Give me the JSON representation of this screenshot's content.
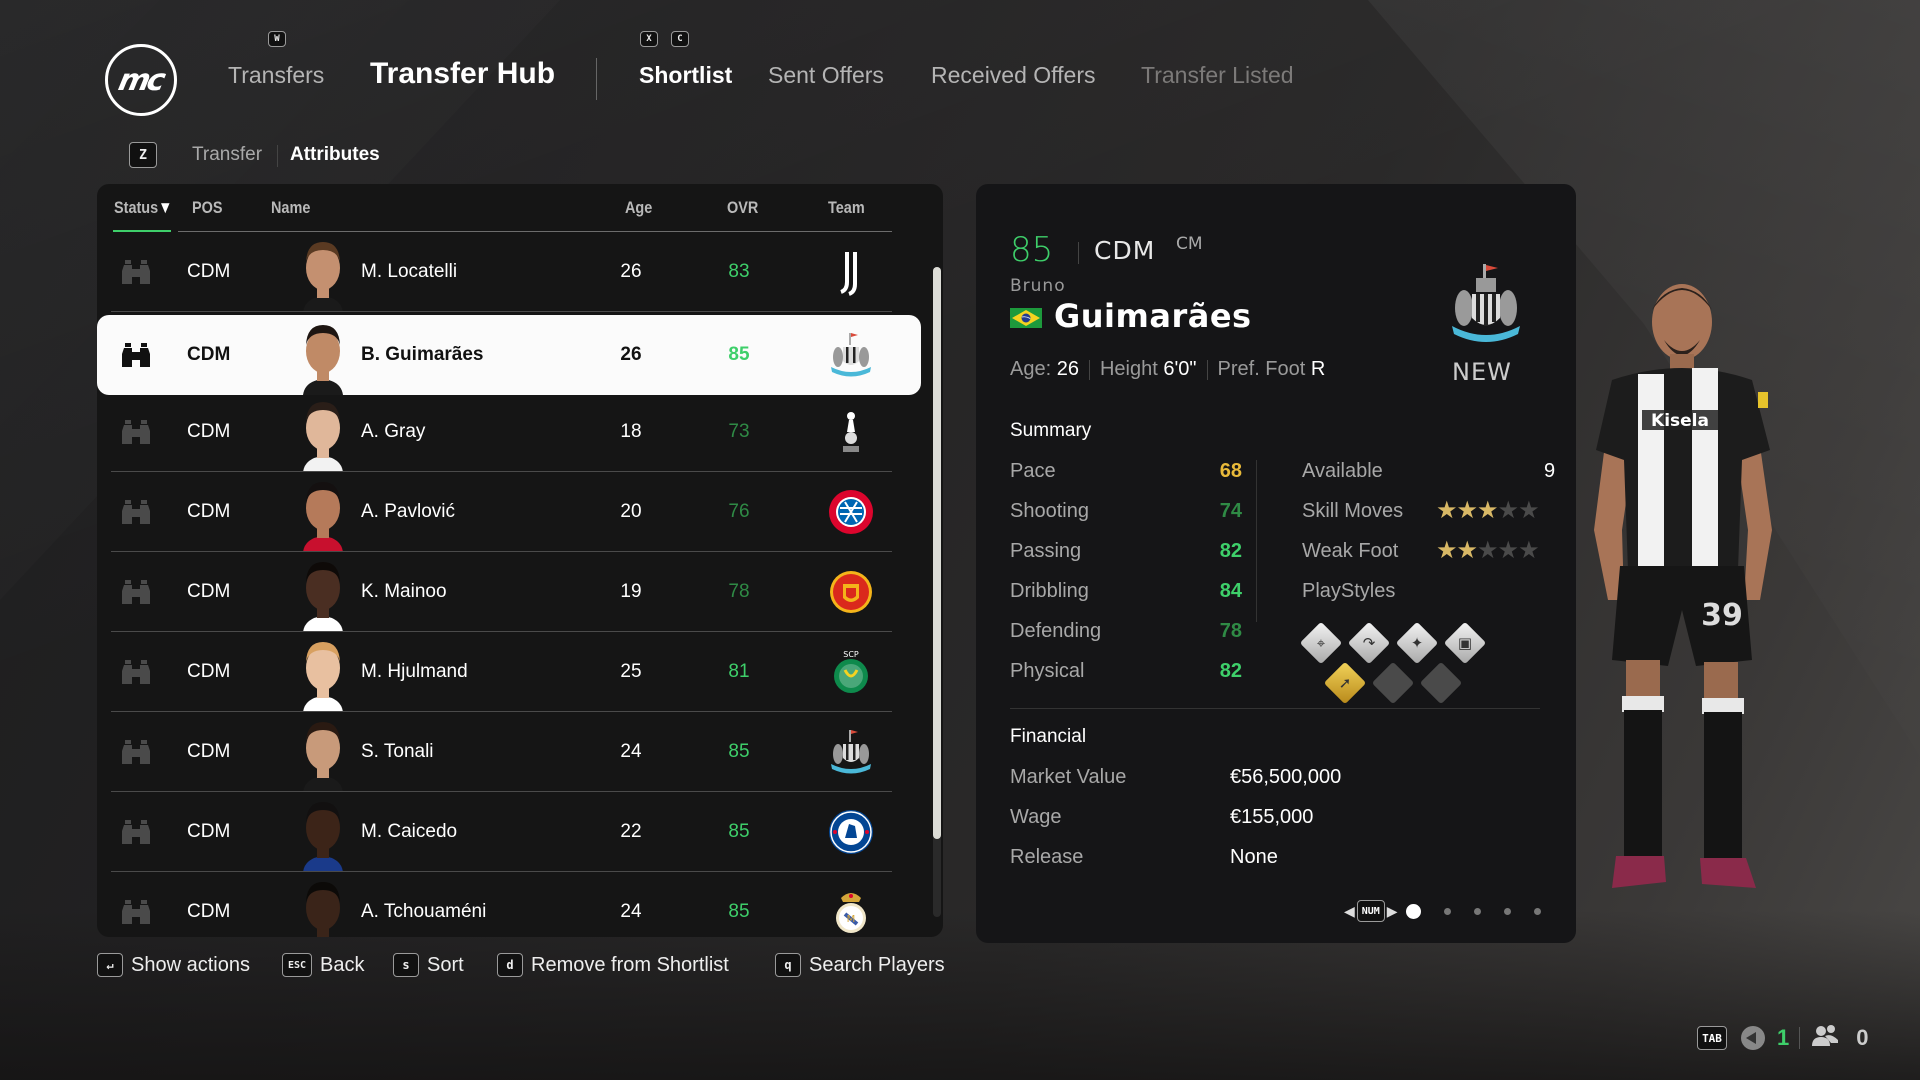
{
  "header": {
    "logo_text": "mc",
    "nav_key_prev": "W",
    "nav_parent": "Transfers",
    "title": "Transfer Hub",
    "tab_keys": [
      "X",
      "C"
    ],
    "tabs": [
      {
        "label": "Shortlist",
        "state": "active"
      },
      {
        "label": "Sent Offers",
        "state": "normal"
      },
      {
        "label": "Received Offers",
        "state": "normal"
      },
      {
        "label": "Transfer Listed",
        "state": "disabled"
      }
    ]
  },
  "subtabs": {
    "key": "Z",
    "items": [
      {
        "label": "Transfer",
        "active": false
      },
      {
        "label": "Attributes",
        "active": true
      }
    ]
  },
  "list": {
    "columns": {
      "status": "Status",
      "sort_indicator": "▼",
      "pos": "POS",
      "name": "Name",
      "age": "Age",
      "ovr": "OVR",
      "team": "Team"
    },
    "scroll_fraction_visible": 0.88,
    "rows": [
      {
        "pos": "CDM",
        "name": "M. Locatelli",
        "age": "26",
        "ovr": "83",
        "ovr_color": "#3ecf6a",
        "team": "Juventus",
        "team_icon": "juventus-crest",
        "selected": false
      },
      {
        "pos": "CDM",
        "name": "B. Guimarães",
        "age": "26",
        "ovr": "85",
        "ovr_color": "#3ecf6a",
        "team": "Newcastle United",
        "team_icon": "newcastle-crest",
        "selected": true
      },
      {
        "pos": "CDM",
        "name": "A. Gray",
        "age": "18",
        "ovr": "73",
        "ovr_color": "#2f8a45",
        "team": "Tottenham Hotspur",
        "team_icon": "tottenham-crest",
        "selected": false
      },
      {
        "pos": "CDM",
        "name": "A. Pavlović",
        "age": "20",
        "ovr": "76",
        "ovr_color": "#2f8a45",
        "team": "FC Bayern München",
        "team_icon": "bayern-crest",
        "selected": false
      },
      {
        "pos": "CDM",
        "name": "K. Mainoo",
        "age": "19",
        "ovr": "78",
        "ovr_color": "#2f8a45",
        "team": "Manchester United",
        "team_icon": "manutd-crest",
        "selected": false
      },
      {
        "pos": "CDM",
        "name": "M. Hjulmand",
        "age": "25",
        "ovr": "81",
        "ovr_color": "#3ecf6a",
        "team": "Sporting CP",
        "team_icon": "sporting-crest",
        "selected": false
      },
      {
        "pos": "CDM",
        "name": "S. Tonali",
        "age": "24",
        "ovr": "85",
        "ovr_color": "#3ecf6a",
        "team": "Newcastle United",
        "team_icon": "newcastle-crest",
        "selected": false
      },
      {
        "pos": "CDM",
        "name": "M. Caicedo",
        "age": "22",
        "ovr": "85",
        "ovr_color": "#3ecf6a",
        "team": "Chelsea",
        "team_icon": "chelsea-crest",
        "selected": false
      },
      {
        "pos": "CDM",
        "name": "A. Tchouaméni",
        "age": "24",
        "ovr": "85",
        "ovr_color": "#3ecf6a",
        "team": "Real Madrid",
        "team_icon": "realmadrid-crest",
        "selected": false
      }
    ]
  },
  "detail": {
    "ovr": "85",
    "position": "CDM",
    "alt_position": "CM",
    "first_name": "Bruno",
    "last_name": "Guimarães",
    "nationality": "Brazil",
    "age_label": "Age:",
    "age": "26",
    "height_label": "Height",
    "height": "6'0\"",
    "foot_label": "Pref. Foot",
    "foot": "R",
    "club_tag": "NEW",
    "summary_title": "Summary",
    "stats": [
      {
        "label": "Pace",
        "value": "68",
        "color": "#e8b93a"
      },
      {
        "label": "Shooting",
        "value": "74",
        "color": "#2f8a45"
      },
      {
        "label": "Passing",
        "value": "82",
        "color": "#3ecf6a"
      },
      {
        "label": "Dribbling",
        "value": "84",
        "color": "#3ecf6a"
      },
      {
        "label": "Defending",
        "value": "78",
        "color": "#2f8a45"
      },
      {
        "label": "Physical",
        "value": "82",
        "color": "#3ecf6a"
      }
    ],
    "available_label": "Available",
    "available": "9",
    "skill_moves_label": "Skill Moves",
    "skill_moves": 3,
    "weak_foot_label": "Weak Foot",
    "weak_foot": 2,
    "stars_max": 5,
    "playstyles_label": "PlayStyles",
    "playstyles": [
      {
        "icon": "location-pin-icon",
        "glyph": "⌖",
        "tier": "silver"
      },
      {
        "icon": "curve-arrow-icon",
        "glyph": "↷",
        "tier": "silver"
      },
      {
        "icon": "sparkle-icon",
        "glyph": "✦",
        "tier": "silver"
      },
      {
        "icon": "safe-icon",
        "glyph": "▣",
        "tier": "silver"
      },
      {
        "icon": "footsteps-icon",
        "glyph": "➚",
        "tier": "gold"
      },
      {
        "icon": "empty-slot-icon",
        "glyph": "",
        "tier": "empty"
      },
      {
        "icon": "empty-slot-icon",
        "glyph": "",
        "tier": "empty"
      }
    ],
    "financial_title": "Financial",
    "financial": [
      {
        "label": "Market Value",
        "value": "€56,500,000"
      },
      {
        "label": "Wage",
        "value": "€155,000"
      },
      {
        "label": "Release",
        "value": "None"
      }
    ],
    "pager": {
      "key": "NUM",
      "pages": 5,
      "current": 1
    }
  },
  "footer_hints": [
    {
      "key": "↵",
      "label": "Show actions"
    },
    {
      "key": "ESC",
      "label": "Back"
    },
    {
      "key": "s",
      "label": "Sort"
    },
    {
      "key": "d",
      "label": "Remove from Shortlist"
    },
    {
      "key": "q",
      "label": "Search Players"
    }
  ],
  "status_bar": {
    "key": "TAB",
    "voice_count": "1",
    "party_count": "0"
  },
  "colors": {
    "accent_green": "#3ecf6a",
    "mid_green": "#2f8a45",
    "gold": "#e8b93a",
    "selected_row_bg": "#fbfbfb"
  }
}
